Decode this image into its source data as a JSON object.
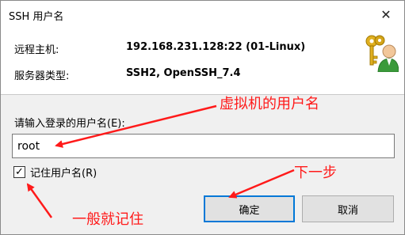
{
  "window": {
    "title": "SSH 用户名",
    "close_glyph": "✕"
  },
  "info": {
    "remote_host_label": "远程主机:",
    "remote_host_value": "192.168.231.128:22 (01-Linux)",
    "server_type_label": "服务器类型:",
    "server_type_value": "SSH2, OpenSSH_7.4",
    "icon": "keys-user-icon"
  },
  "form": {
    "username_label": "请输入登录的用户名(E):",
    "username_value": "root",
    "remember_label": "记住用户名(R)",
    "remember_checked": true
  },
  "buttons": {
    "ok_label": "确定",
    "cancel_label": "取消"
  },
  "annotations": {
    "vm_username": "虚拟机的用户名",
    "next_step": "下一步",
    "usually_remember": "一般就记住"
  },
  "colors": {
    "annotation": "#ff1a1a",
    "focus_border": "#0078d7",
    "panel_bg": "#f0f0f0"
  }
}
